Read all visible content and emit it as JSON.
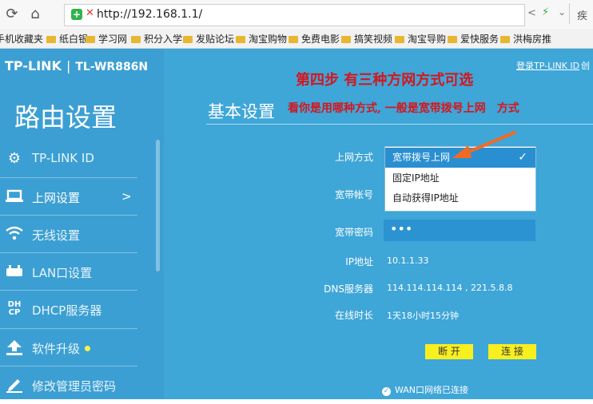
{
  "browser": {
    "url": "http://192.168.1.1/",
    "right_text": "疾",
    "bookmarks": [
      {
        "label": "手机收藏夹",
        "folder": false
      },
      {
        "label": "纸白银",
        "folder": true
      },
      {
        "label": "学习网",
        "folder": true
      },
      {
        "label": "积分入学",
        "folder": true
      },
      {
        "label": "发贴论坛",
        "folder": true
      },
      {
        "label": "淘宝购物",
        "folder": true
      },
      {
        "label": "免费电影",
        "folder": true
      },
      {
        "label": "搞笑视频",
        "folder": true
      },
      {
        "label": "淘宝导购",
        "folder": true
      },
      {
        "label": "爱快服务",
        "folder": true
      },
      {
        "label": "洪梅房推",
        "folder": true
      }
    ]
  },
  "router": {
    "brand": "TP-LINK",
    "model": "TL-WR886N",
    "login_link": "登录TP-LINK ID",
    "create_link": "创",
    "page_title": "路由设置",
    "sidebar": [
      {
        "label": "TP-LINK ID",
        "icon": "gear-icon"
      },
      {
        "label": "上网设置",
        "icon": "laptop-icon",
        "chevron": ">"
      },
      {
        "label": "无线设置",
        "icon": "wifi-icon"
      },
      {
        "label": "LAN口设置",
        "icon": "router-icon"
      },
      {
        "label": "DHCP服务器",
        "icon": "dhcp-icon",
        "icon_text": "DH CP"
      },
      {
        "label": "软件升级",
        "icon": "upload-icon"
      },
      {
        "label": "修改管理员密码",
        "icon": "edit-icon"
      }
    ],
    "section_title": "基本设置",
    "annotations": {
      "step": "第四步 有三种方网方式可选",
      "hint": "看你是用哪种方式, 一般是宽带拨号上网　方式"
    },
    "form": {
      "conn_type_label": "上网方式",
      "options": [
        "宽带拨号上网",
        "固定IP地址",
        "自动获得IP地址"
      ],
      "account_label": "宽带帐号",
      "password_label": "宽带密码",
      "password_value": "•••",
      "ip_label": "IP地址",
      "ip_value": "10.1.1.33",
      "dns_label": "DNS服务器",
      "dns_value": "114.114.114.114 , 221.5.8.8",
      "uptime_label": "在线时长",
      "uptime_value": "1天18小时15分钟",
      "disconnect": "断 开",
      "connect": "连 接",
      "status": "WAN口网络已连接"
    }
  },
  "colors": {
    "page_bg": "#3fa6d8",
    "sidebar_bg": "#3c9fd3",
    "annotation": "#d4161d",
    "button": "#f8ef1e",
    "selected_option": "#2a8fd0"
  }
}
